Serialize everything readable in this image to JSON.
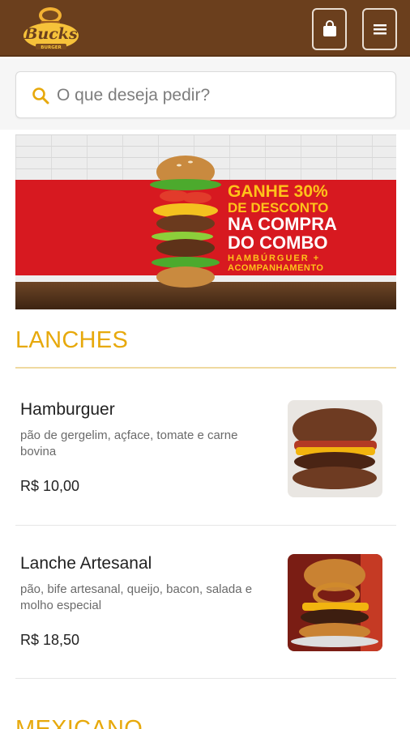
{
  "header": {
    "logo_text": "Bucks",
    "logo_subtext": "BURGER"
  },
  "search": {
    "placeholder": "O que deseja pedir?"
  },
  "banner": {
    "line1": "GANHE 30%",
    "line2": "DE DESCONTO",
    "line3": "NA COMPRA",
    "line4": "DO COMBO",
    "line5": "HAMBÚRGUER +",
    "line6": "ACOMPANHAMENTO"
  },
  "sections": [
    {
      "title": "LANCHES",
      "products": [
        {
          "name": "Hamburguer",
          "description": "pão de gergelim, açface, tomate e carne bovina",
          "price": "R$ 10,00"
        },
        {
          "name": "Lanche Artesanal",
          "description": "pão, bife artesanal, queijo, bacon, salada e molho especial",
          "price": "R$ 18,50"
        }
      ]
    },
    {
      "title": "MEXICANO"
    }
  ],
  "colors": {
    "header": "#6b3f1d",
    "accent": "#e7a90c",
    "promo_red": "#d71920"
  },
  "icons": {
    "bag": "shopping-bag-icon",
    "menu": "hamburger-menu-icon",
    "search": "search-icon"
  }
}
